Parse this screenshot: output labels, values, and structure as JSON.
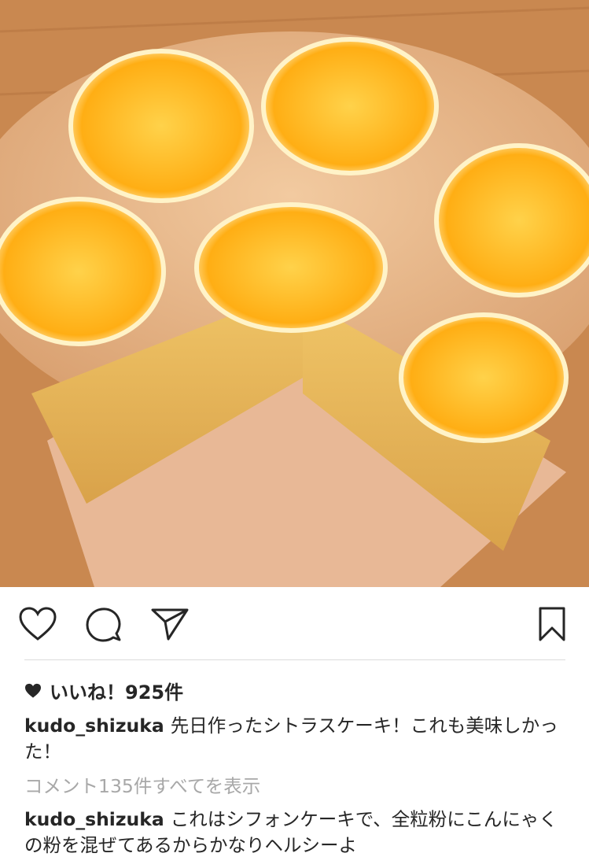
{
  "post": {
    "image_subject": "citrus-cake-photo",
    "actions": {
      "like_icon": "heart-outline-icon",
      "comment_icon": "comment-bubble-icon",
      "share_icon": "paper-plane-icon",
      "save_icon": "bookmark-icon"
    },
    "likes_text": "いいね！925件",
    "caption": {
      "username": "kudo_shizuka",
      "text": "先日作ったシトラスケーキ！これも美味しかった！"
    },
    "view_comments": "コメント135件すべてを表示",
    "comment": {
      "username": "kudo_shizuka",
      "text": "これはシフォンケーキで、全粒粉にこんにゃくの粉を混ぜてあるからかなりヘルシーよ"
    }
  },
  "colors": {
    "text": "#262626",
    "muted": "#a8a8a8",
    "divider": "#dbdbdb",
    "orange": "#ffb81c"
  }
}
